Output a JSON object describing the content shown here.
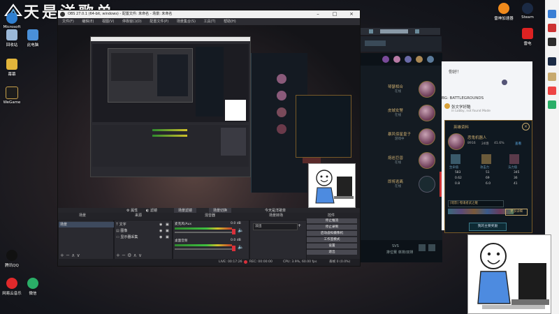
{
  "watermark": {
    "text": "天是洋歌单"
  },
  "desktop_icons": [
    {
      "label": "Microsoft Edge",
      "color": "#2f7fd0"
    },
    {
      "label": "回收站",
      "color": "#9bb8d8"
    },
    {
      "label": "此电脑",
      "color": "#4a90d9"
    },
    {
      "label": "幕幕",
      "color": "#e2b53b"
    },
    {
      "label": "WeGame",
      "color": "#1c1c1c"
    },
    {
      "label": "腾讯QQ",
      "color": "#000000"
    },
    {
      "label": "网易云音乐",
      "color": "#e0292b"
    },
    {
      "label": "微信",
      "color": "#2aae67"
    }
  ],
  "top_right_icons": [
    {
      "label": "雷神加速器",
      "color": "#f08a1c"
    },
    {
      "label": "Steam",
      "color": "#1b2a44"
    },
    {
      "label": "英雄联盟",
      "color": "#c8aa6e"
    },
    {
      "label": "雷电",
      "color": "#d22"
    }
  ],
  "obs": {
    "title": "OBS 27.0.1 (64-bit, windows) - 配置文件: 未命名 - 场景: 未命名",
    "menu": [
      "文件(F)",
      "编辑(E)",
      "视图(V)",
      "停靠窗口(D)",
      "配置文件(P)",
      "场景集合(S)",
      "工具(T)",
      "帮助(H)"
    ],
    "toolbar": {
      "properties": "属性",
      "filters": "滤镜",
      "scene_filters": "场景滤镜",
      "hotkey": "场景切换",
      "custom": "今天是洋歌单"
    },
    "docks": {
      "scenes": "场景",
      "sources": "来源",
      "mixer": "混音器",
      "transitions": "场景转场",
      "controls": "控件"
    },
    "scene_item": "场景",
    "sources": [
      "文字",
      "图像",
      "显示器采集"
    ],
    "mixer": [
      {
        "name": "麦克风/Aux",
        "db": "0.0 dB"
      },
      {
        "name": "桌面音频",
        "db": "0.0 dB"
      }
    ],
    "transition": {
      "value": "淡出",
      "duration_label": "时长",
      "duration": "300 ms"
    },
    "controls": [
      "停止推流",
      "停止录制",
      "启动虚拟摄像机",
      "工作室模式",
      "设置",
      "退出"
    ],
    "status": {
      "live": "LIVE: 00:17:26",
      "rec": "REC: 00:00:00",
      "cpu": "CPU: 3.9%, 60.00 fps",
      "dropped": "丢帧 0 (0.0%)"
    }
  },
  "lol_chat": {
    "friends": [
      {
        "name": "琴瑟相合",
        "status": "在线"
      },
      {
        "name": "皮城女警",
        "status": "在线"
      },
      {
        "name": "暴风佰星皇子",
        "status": "游戏中"
      },
      {
        "name": "熔岩巨兽",
        "status": "在线"
      },
      {
        "name": "即将逃离",
        "status": "在线"
      }
    ],
    "footer": {
      "version": "SVS",
      "ranked": "排位赛 单排/双排"
    }
  },
  "lol_side": {
    "header": "你好！",
    "game_label": "BG: BATTLEGROUNDS",
    "player": "张文学好酷",
    "sub": "in Lobby, not found Mode"
  },
  "profile_card": {
    "title": "英雄资料",
    "name": "恶鬼机器人",
    "stats": [
      "8916",
      "24场",
      "41.6%"
    ],
    "link": "查看",
    "row_labels": [
      "生命值",
      "攻击力",
      "法力值"
    ],
    "values": [
      "583",
      "51",
      "345",
      "0.62",
      "69",
      "36",
      "0.8",
      "6.0",
      "41"
    ],
    "select": "[暗影] 噬魂者武之躯",
    "action": "更多详细",
    "bottom_button": "我的主要奖励"
  },
  "colors": {
    "obs_bg": "#26262b",
    "accent_gold": "#c8aa6e",
    "obs_btn": "#4a4a52",
    "live_red": "#d9303a"
  }
}
